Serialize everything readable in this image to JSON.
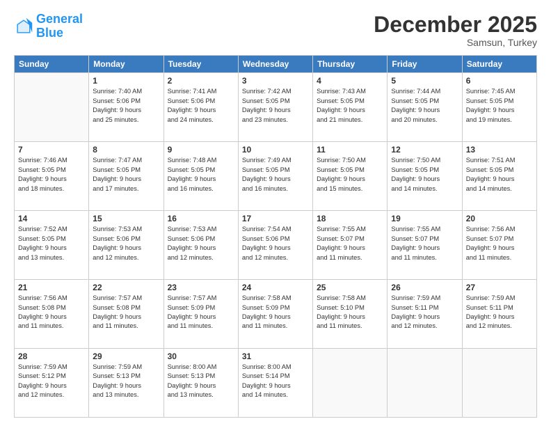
{
  "header": {
    "logo_line1": "General",
    "logo_line2": "Blue",
    "month_title": "December 2025",
    "location": "Samsun, Turkey"
  },
  "weekdays": [
    "Sunday",
    "Monday",
    "Tuesday",
    "Wednesday",
    "Thursday",
    "Friday",
    "Saturday"
  ],
  "days": [
    {
      "date": "",
      "info": ""
    },
    {
      "date": "1",
      "info": "Sunrise: 7:40 AM\nSunset: 5:06 PM\nDaylight: 9 hours\nand 25 minutes."
    },
    {
      "date": "2",
      "info": "Sunrise: 7:41 AM\nSunset: 5:06 PM\nDaylight: 9 hours\nand 24 minutes."
    },
    {
      "date": "3",
      "info": "Sunrise: 7:42 AM\nSunset: 5:05 PM\nDaylight: 9 hours\nand 23 minutes."
    },
    {
      "date": "4",
      "info": "Sunrise: 7:43 AM\nSunset: 5:05 PM\nDaylight: 9 hours\nand 21 minutes."
    },
    {
      "date": "5",
      "info": "Sunrise: 7:44 AM\nSunset: 5:05 PM\nDaylight: 9 hours\nand 20 minutes."
    },
    {
      "date": "6",
      "info": "Sunrise: 7:45 AM\nSunset: 5:05 PM\nDaylight: 9 hours\nand 19 minutes."
    },
    {
      "date": "7",
      "info": "Sunrise: 7:46 AM\nSunset: 5:05 PM\nDaylight: 9 hours\nand 18 minutes."
    },
    {
      "date": "8",
      "info": "Sunrise: 7:47 AM\nSunset: 5:05 PM\nDaylight: 9 hours\nand 17 minutes."
    },
    {
      "date": "9",
      "info": "Sunrise: 7:48 AM\nSunset: 5:05 PM\nDaylight: 9 hours\nand 16 minutes."
    },
    {
      "date": "10",
      "info": "Sunrise: 7:49 AM\nSunset: 5:05 PM\nDaylight: 9 hours\nand 16 minutes."
    },
    {
      "date": "11",
      "info": "Sunrise: 7:50 AM\nSunset: 5:05 PM\nDaylight: 9 hours\nand 15 minutes."
    },
    {
      "date": "12",
      "info": "Sunrise: 7:50 AM\nSunset: 5:05 PM\nDaylight: 9 hours\nand 14 minutes."
    },
    {
      "date": "13",
      "info": "Sunrise: 7:51 AM\nSunset: 5:05 PM\nDaylight: 9 hours\nand 14 minutes."
    },
    {
      "date": "14",
      "info": "Sunrise: 7:52 AM\nSunset: 5:05 PM\nDaylight: 9 hours\nand 13 minutes."
    },
    {
      "date": "15",
      "info": "Sunrise: 7:53 AM\nSunset: 5:06 PM\nDaylight: 9 hours\nand 12 minutes."
    },
    {
      "date": "16",
      "info": "Sunrise: 7:53 AM\nSunset: 5:06 PM\nDaylight: 9 hours\nand 12 minutes."
    },
    {
      "date": "17",
      "info": "Sunrise: 7:54 AM\nSunset: 5:06 PM\nDaylight: 9 hours\nand 12 minutes."
    },
    {
      "date": "18",
      "info": "Sunrise: 7:55 AM\nSunset: 5:07 PM\nDaylight: 9 hours\nand 11 minutes."
    },
    {
      "date": "19",
      "info": "Sunrise: 7:55 AM\nSunset: 5:07 PM\nDaylight: 9 hours\nand 11 minutes."
    },
    {
      "date": "20",
      "info": "Sunrise: 7:56 AM\nSunset: 5:07 PM\nDaylight: 9 hours\nand 11 minutes."
    },
    {
      "date": "21",
      "info": "Sunrise: 7:56 AM\nSunset: 5:08 PM\nDaylight: 9 hours\nand 11 minutes."
    },
    {
      "date": "22",
      "info": "Sunrise: 7:57 AM\nSunset: 5:08 PM\nDaylight: 9 hours\nand 11 minutes."
    },
    {
      "date": "23",
      "info": "Sunrise: 7:57 AM\nSunset: 5:09 PM\nDaylight: 9 hours\nand 11 minutes."
    },
    {
      "date": "24",
      "info": "Sunrise: 7:58 AM\nSunset: 5:09 PM\nDaylight: 9 hours\nand 11 minutes."
    },
    {
      "date": "25",
      "info": "Sunrise: 7:58 AM\nSunset: 5:10 PM\nDaylight: 9 hours\nand 11 minutes."
    },
    {
      "date": "26",
      "info": "Sunrise: 7:59 AM\nSunset: 5:11 PM\nDaylight: 9 hours\nand 12 minutes."
    },
    {
      "date": "27",
      "info": "Sunrise: 7:59 AM\nSunset: 5:11 PM\nDaylight: 9 hours\nand 12 minutes."
    },
    {
      "date": "28",
      "info": "Sunrise: 7:59 AM\nSunset: 5:12 PM\nDaylight: 9 hours\nand 12 minutes."
    },
    {
      "date": "29",
      "info": "Sunrise: 7:59 AM\nSunset: 5:13 PM\nDaylight: 9 hours\nand 13 minutes."
    },
    {
      "date": "30",
      "info": "Sunrise: 8:00 AM\nSunset: 5:13 PM\nDaylight: 9 hours\nand 13 minutes."
    },
    {
      "date": "31",
      "info": "Sunrise: 8:00 AM\nSunset: 5:14 PM\nDaylight: 9 hours\nand 14 minutes."
    }
  ]
}
